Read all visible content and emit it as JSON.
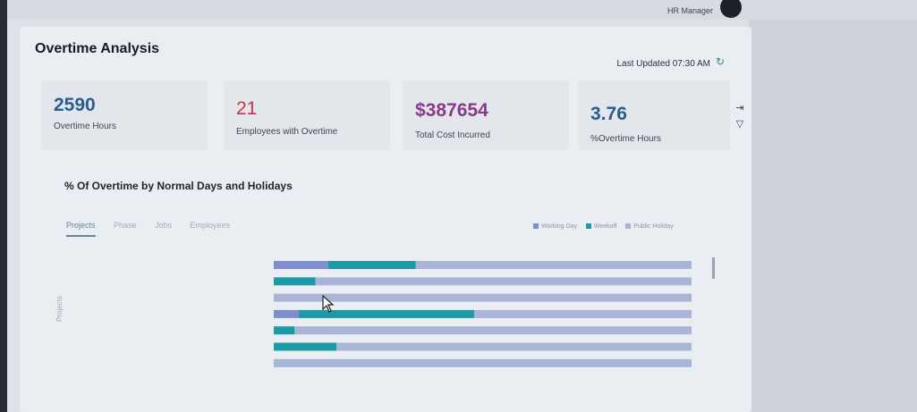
{
  "header": {
    "user_name": "HR Manager"
  },
  "page": {
    "title": "Overtime Analysis",
    "last_updated": "Last Updated 07:30 AM"
  },
  "kpis": [
    {
      "value": "2590",
      "label": "Overtime Hours",
      "color": "#2a5d8f"
    },
    {
      "value": "21",
      "label": "Employees with Overtime",
      "color": "#c3344a"
    },
    {
      "value": "$387654",
      "label": "Total Cost Incurred",
      "color": "#8a3a8a"
    },
    {
      "value": "3.76",
      "label": "%Overtime Hours",
      "color": "#2a5d8f"
    }
  ],
  "chart_section": {
    "title": "% Of Overtime by Normal Days and Holidays",
    "tabs": [
      "Projects",
      "Phase",
      "Jobs",
      "Employees"
    ],
    "active_tab": 0,
    "y_axis_title": "Projects",
    "legend": [
      {
        "name": "Working Day",
        "color": "#7f8ecf"
      },
      {
        "name": "Weekoff",
        "color": "#1c9aa5"
      },
      {
        "name": "Public Holiday",
        "color": "#a9b5d6"
      }
    ]
  },
  "chart_data": {
    "type": "bar",
    "orientation": "horizontal",
    "stacked": true,
    "xlim": [
      0,
      100
    ],
    "categories": [
      "",
      "",
      "",
      "",
      "",
      "",
      ""
    ],
    "series": [
      {
        "name": "Working Day",
        "values": [
          13,
          0,
          0,
          6,
          0,
          0,
          0
        ]
      },
      {
        "name": "Weekoff",
        "values": [
          21,
          10,
          0,
          42,
          5,
          15,
          0
        ]
      },
      {
        "name": "Public Holiday",
        "values": [
          66,
          90,
          100,
          52,
          95,
          85,
          100
        ]
      }
    ]
  }
}
